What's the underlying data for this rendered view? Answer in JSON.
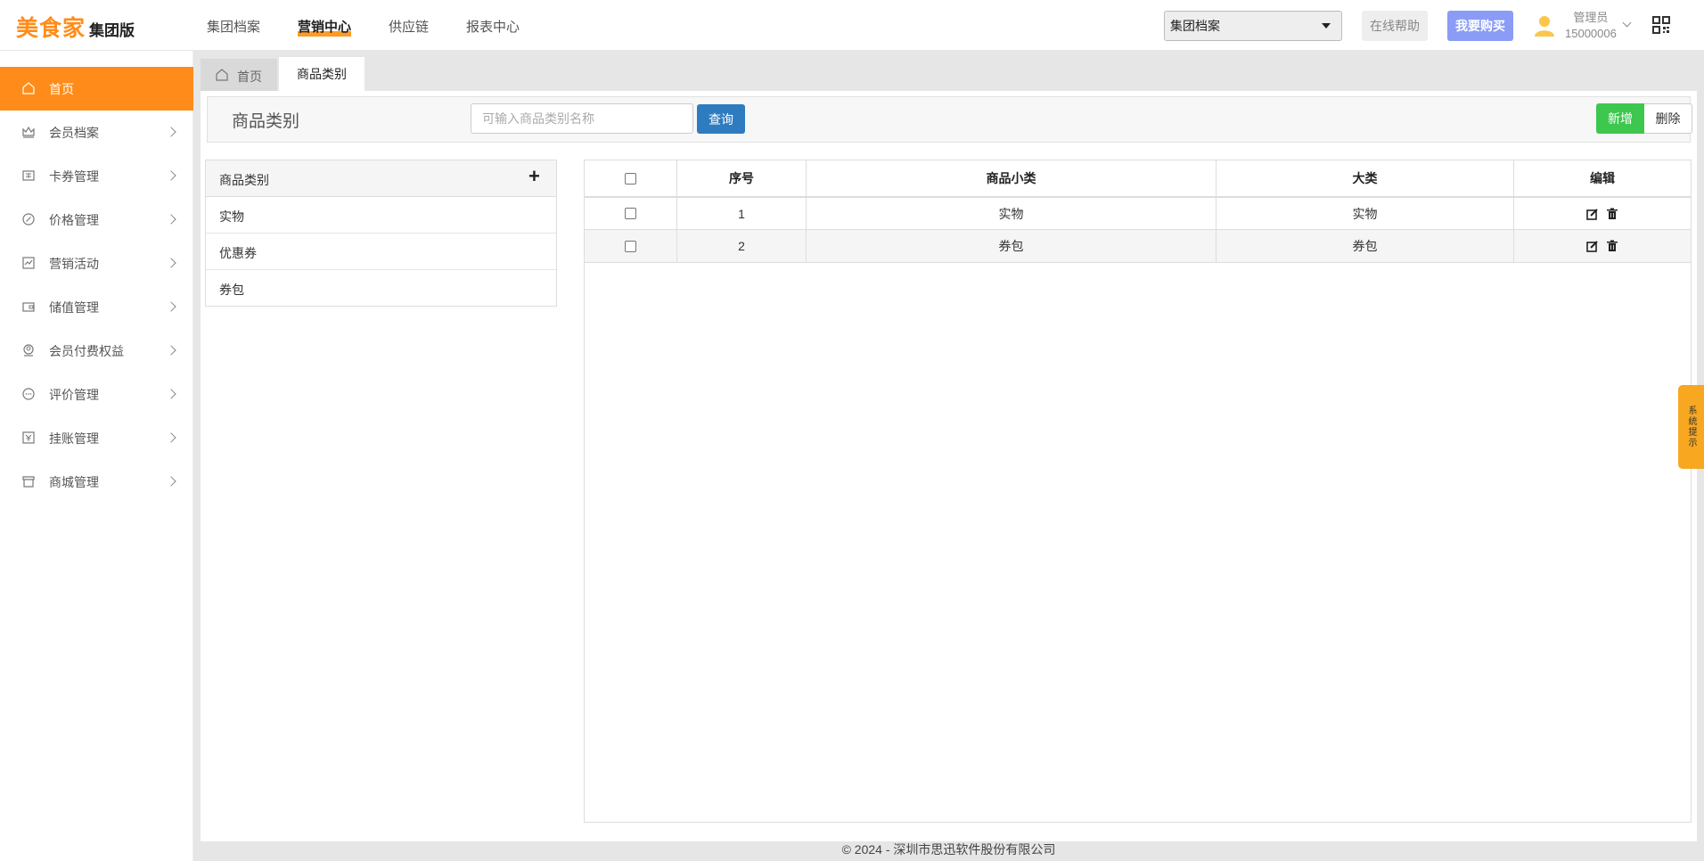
{
  "header": {
    "logo_main": "美食家",
    "logo_sub": "集团版",
    "nav": [
      {
        "label": "集团档案"
      },
      {
        "label": "营销中心"
      },
      {
        "label": "供应链"
      },
      {
        "label": "报表中心"
      }
    ],
    "org_select_value": "集团档案",
    "help_label": "在线帮助",
    "buy_label": "我要购买",
    "user_role": "管理员",
    "user_id": "15000006",
    "accent_color": "#ff8c1a"
  },
  "sidebar": {
    "items": [
      {
        "label": "首页",
        "icon": "home-icon"
      },
      {
        "label": "会员档案",
        "icon": "crown-icon"
      },
      {
        "label": "卡券管理",
        "icon": "coupon-icon"
      },
      {
        "label": "价格管理",
        "icon": "price-icon"
      },
      {
        "label": "营销活动",
        "icon": "chart-icon"
      },
      {
        "label": "储值管理",
        "icon": "wallet-icon"
      },
      {
        "label": "会员付费权益",
        "icon": "member-icon"
      },
      {
        "label": "评价管理",
        "icon": "comment-icon"
      },
      {
        "label": "挂账管理",
        "icon": "ledger-icon"
      },
      {
        "label": "商城管理",
        "icon": "shop-icon"
      }
    ]
  },
  "tabs": [
    {
      "label": "首页"
    },
    {
      "label": "商品类别"
    }
  ],
  "toolbar": {
    "title": "商品类别",
    "search_placeholder": "可输入商品类别名称",
    "query_label": "查询",
    "add_label": "新增",
    "delete_label": "删除"
  },
  "category_panel": {
    "header": "商品类别",
    "items": [
      {
        "label": "实物"
      },
      {
        "label": "优惠券"
      },
      {
        "label": "券包"
      }
    ]
  },
  "table": {
    "columns": [
      "序号",
      "商品小类",
      "大类",
      "编辑"
    ],
    "rows": [
      {
        "index": "1",
        "sub": "实物",
        "major": "实物"
      },
      {
        "index": "2",
        "sub": "券包",
        "major": "券包"
      }
    ]
  },
  "footer": "© 2024 - 深圳市思迅软件股份有限公司",
  "side_tip": "系统提示"
}
